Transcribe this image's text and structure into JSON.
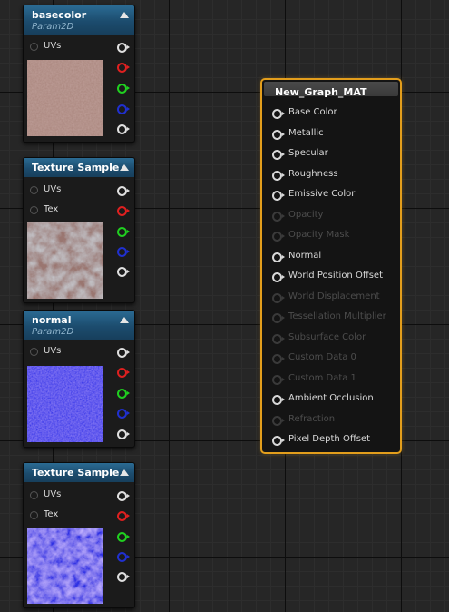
{
  "graph": {
    "nodes": [
      {
        "title": "basecolor",
        "subtitle": "Param2D",
        "inputs": [
          "UVs"
        ],
        "preview": "rose-noise"
      },
      {
        "title": "Texture Sample",
        "subtitle": "",
        "inputs": [
          "UVs",
          "Tex"
        ],
        "preview": "rose-camo"
      },
      {
        "title": "normal",
        "subtitle": "Param2D",
        "inputs": [
          "UVs"
        ],
        "preview": "blue-normal"
      },
      {
        "title": "Texture Sample",
        "subtitle": "",
        "inputs": [
          "UVs",
          "Tex"
        ],
        "preview": "blue-normal-varied"
      }
    ],
    "output_pin_colors": [
      "#e0e0e0",
      "#e02020",
      "#20d020",
      "#2030d0",
      "#e0e0e0"
    ],
    "material": {
      "title": "New_Graph_MAT",
      "pins": [
        {
          "label": "Base Color",
          "enabled": true
        },
        {
          "label": "Metallic",
          "enabled": true
        },
        {
          "label": "Specular",
          "enabled": true
        },
        {
          "label": "Roughness",
          "enabled": true
        },
        {
          "label": "Emissive Color",
          "enabled": true
        },
        {
          "label": "Opacity",
          "enabled": false
        },
        {
          "label": "Opacity Mask",
          "enabled": false
        },
        {
          "label": "Normal",
          "enabled": true
        },
        {
          "label": "World Position Offset",
          "enabled": true
        },
        {
          "label": "World Displacement",
          "enabled": false
        },
        {
          "label": "Tessellation Multiplier",
          "enabled": false
        },
        {
          "label": "Subsurface Color",
          "enabled": false
        },
        {
          "label": "Custom Data 0",
          "enabled": false
        },
        {
          "label": "Custom Data 1",
          "enabled": false
        },
        {
          "label": "Ambient Occlusion",
          "enabled": true
        },
        {
          "label": "Refraction",
          "enabled": false
        },
        {
          "label": "Pixel Depth Offset",
          "enabled": true
        }
      ]
    }
  }
}
